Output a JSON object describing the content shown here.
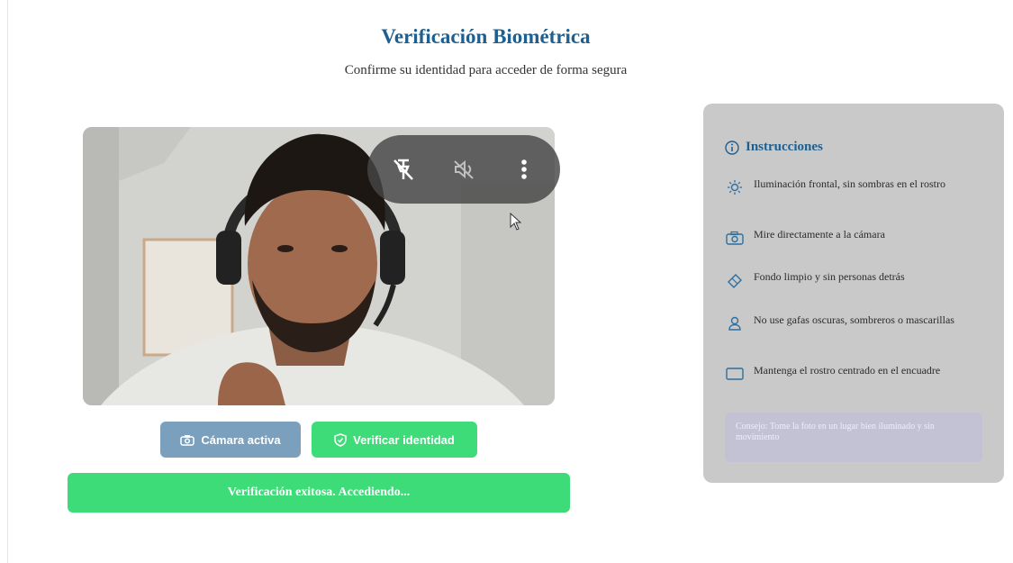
{
  "header": {
    "title": "Verificación Biométrica",
    "subtitle": "Confirme su identidad para acceder de forma segura"
  },
  "camera": {
    "overlay_icons": [
      "pin-off-icon",
      "mute-icon",
      "more-vertical-icon"
    ]
  },
  "buttons": {
    "camera_label": "Cámara activa",
    "verify_label": "Verificar identidad"
  },
  "status": {
    "message": "Verificación exitosa. Accediendo..."
  },
  "instructions": {
    "title": "Instrucciones",
    "items": [
      {
        "icon": "sun-icon",
        "text": "Iluminación frontal, sin sombras en el rostro"
      },
      {
        "icon": "camera-icon",
        "text": "Mire directamente a la cámara"
      },
      {
        "icon": "eraser-icon",
        "text": "Fondo limpio y sin personas detrás"
      },
      {
        "icon": "user-icon",
        "text": "No use gafas oscuras, sombreros o mascarillas"
      },
      {
        "icon": "frame-icon",
        "text": "Mantenga el rostro centrado en el encuadre"
      }
    ],
    "tip": "Consejo: Tome la foto en un lugar bien iluminado y sin movimiento"
  },
  "colors": {
    "title": "#1f5f8f",
    "success": "#3ddc78",
    "camera_button": "#7ba0bd",
    "panel": "#c9c9c9"
  }
}
